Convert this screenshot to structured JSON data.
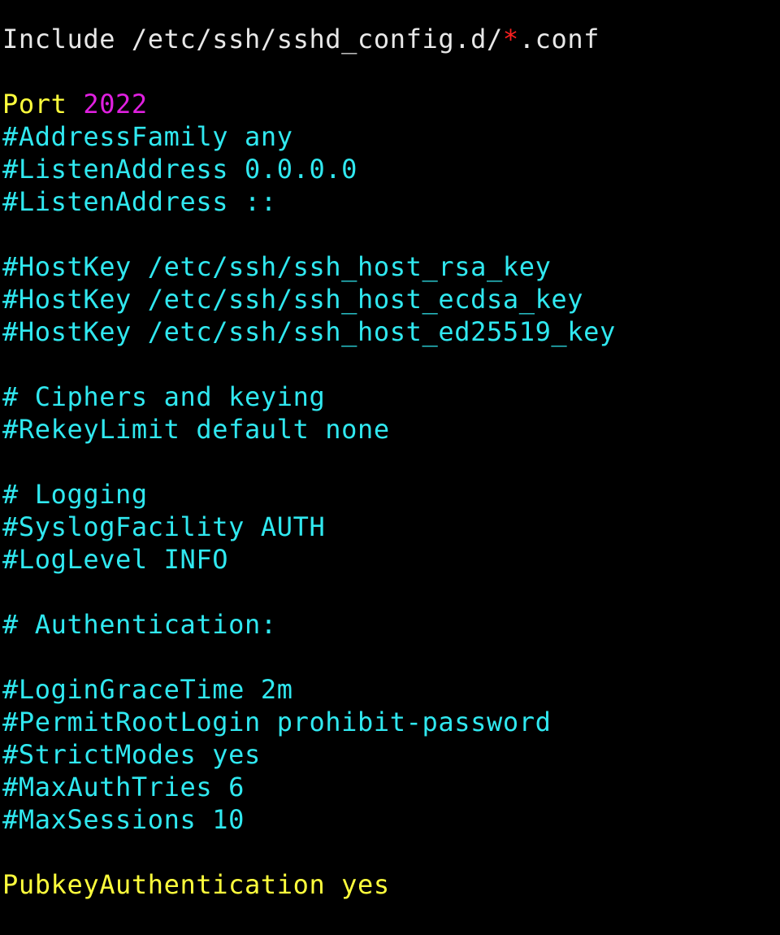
{
  "terminal": {
    "colors": {
      "background": "#000000",
      "text": "#e8e8e8",
      "keyword": "#ffff3c",
      "number": "#e020e0",
      "comment": "#30e8f0",
      "glob": "#ff2020"
    },
    "lines": [
      {
        "parts": [
          "Include /etc/ssh/sshd_config.d/",
          "*",
          ".conf"
        ]
      },
      {
        "parts": []
      },
      {
        "parts": [
          "Port ",
          "2022"
        ]
      },
      {
        "parts": [
          "#AddressFamily any"
        ]
      },
      {
        "parts": [
          "#ListenAddress 0.0.0.0"
        ]
      },
      {
        "parts": [
          "#ListenAddress ::"
        ]
      },
      {
        "parts": []
      },
      {
        "parts": [
          "#HostKey /etc/ssh/ssh_host_rsa_key"
        ]
      },
      {
        "parts": [
          "#HostKey /etc/ssh/ssh_host_ecdsa_key"
        ]
      },
      {
        "parts": [
          "#HostKey /etc/ssh/ssh_host_ed25519_key"
        ]
      },
      {
        "parts": []
      },
      {
        "parts": [
          "# Ciphers and keying"
        ]
      },
      {
        "parts": [
          "#RekeyLimit default none"
        ]
      },
      {
        "parts": []
      },
      {
        "parts": [
          "# Logging"
        ]
      },
      {
        "parts": [
          "#SyslogFacility AUTH"
        ]
      },
      {
        "parts": [
          "#LogLevel INFO"
        ]
      },
      {
        "parts": []
      },
      {
        "parts": [
          "# Authentication:"
        ]
      },
      {
        "parts": []
      },
      {
        "parts": [
          "#LoginGraceTime 2m"
        ]
      },
      {
        "parts": [
          "#PermitRootLogin prohibit-password"
        ]
      },
      {
        "parts": [
          "#StrictModes yes"
        ]
      },
      {
        "parts": [
          "#MaxAuthTries 6"
        ]
      },
      {
        "parts": [
          "#MaxSessions 10"
        ]
      },
      {
        "parts": []
      },
      {
        "parts": [
          "PubkeyAuthentication yes"
        ]
      }
    ]
  }
}
